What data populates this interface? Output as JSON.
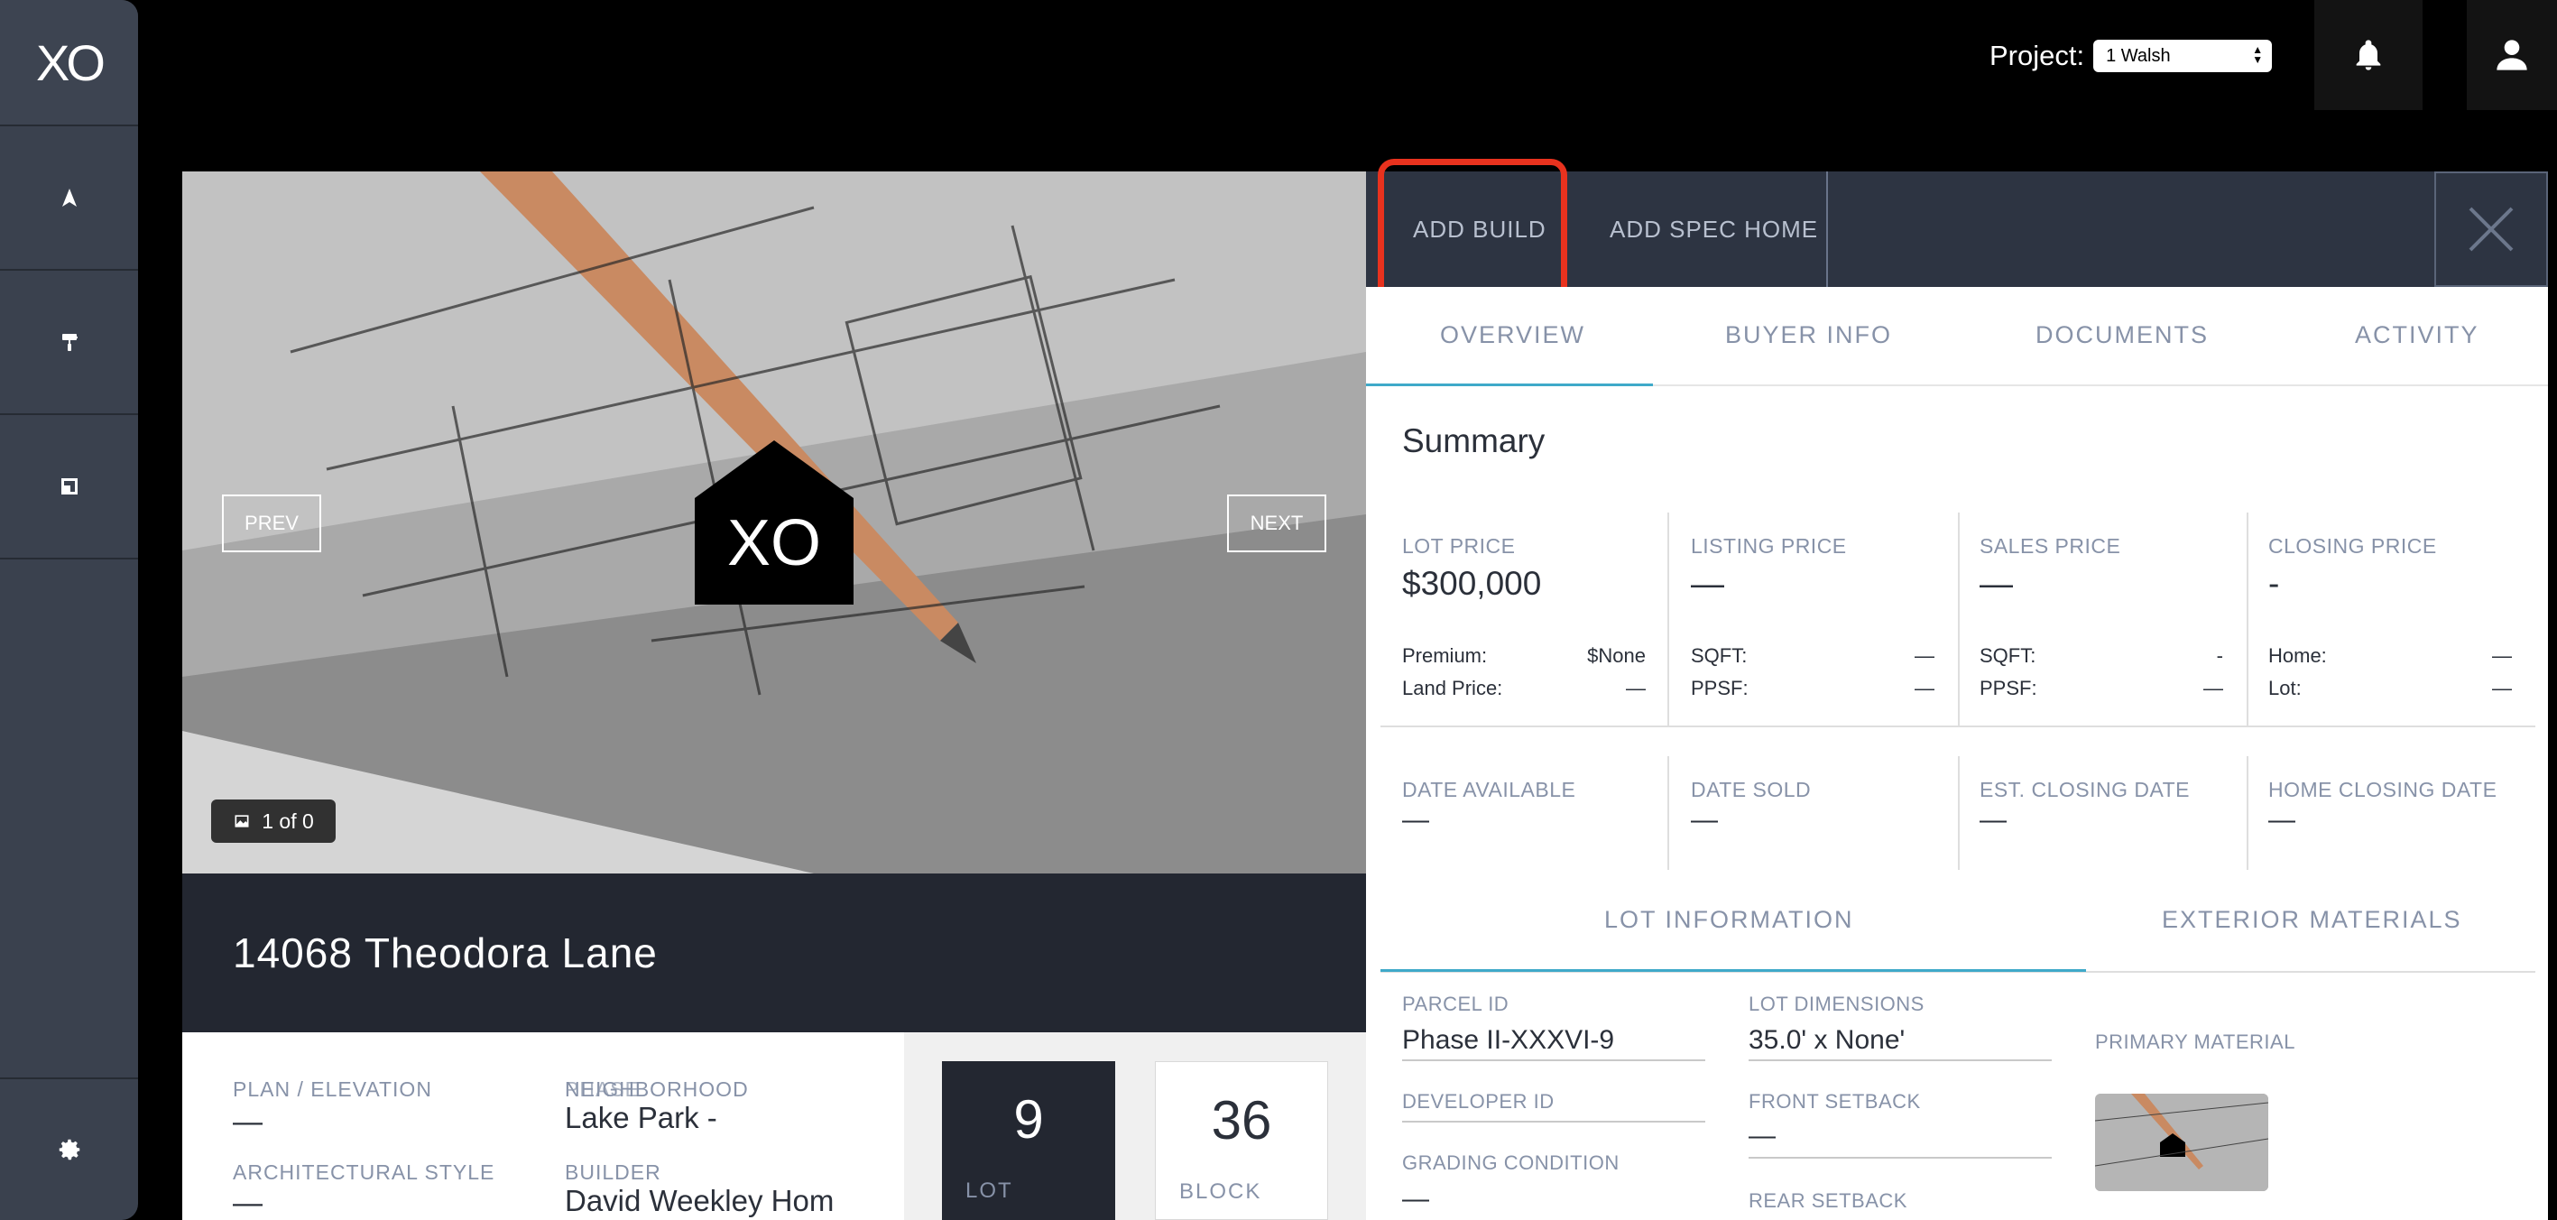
{
  "sidebar": {
    "logo": "XO"
  },
  "topbar": {
    "project_label": "Project:",
    "project_value": "1 Walsh"
  },
  "photo": {
    "prev_label": "PREV",
    "next_label": "NEXT",
    "counter": "1 of 0",
    "badge_text": "XO"
  },
  "property": {
    "address": "14068 Theodora Lane",
    "plan_elevation_label": "PLAN / ELEVATION",
    "plan_elevation_value": "—",
    "phase_label": "PHASE",
    "neighborhood_label": "NEIGHBORHOOD",
    "neighborhood_value": "Lake Park -",
    "architectural_style_label": "ARCHITECTURAL STYLE",
    "architectural_style_value": "—",
    "builder_label": "BUILDER",
    "builder_value": "David Weekley Hom",
    "lot_number": "9",
    "lot_label": "LOT",
    "block_number": "36",
    "block_label": "BLOCK"
  },
  "panel": {
    "add_build": "ADD BUILD",
    "add_spec_home": "ADD SPEC HOME",
    "tabs": [
      "OVERVIEW",
      "BUYER INFO",
      "DOCUMENTS",
      "ACTIVITY"
    ],
    "summary_title": "Summary",
    "prices": [
      {
        "label": "LOT PRICE",
        "value": "$300,000",
        "rows": [
          {
            "k": "Premium:",
            "v": "$None"
          },
          {
            "k": "Land Price:",
            "v": "—"
          }
        ]
      },
      {
        "label": "LISTING PRICE",
        "value": "—",
        "rows": [
          {
            "k": "SQFT:",
            "v": "—"
          },
          {
            "k": "PPSF:",
            "v": "—"
          }
        ]
      },
      {
        "label": "SALES PRICE",
        "value": "—",
        "rows": [
          {
            "k": "SQFT:",
            "v": "-"
          },
          {
            "k": "PPSF:",
            "v": "—"
          }
        ]
      },
      {
        "label": "CLOSING PRICE",
        "value": "-",
        "rows": [
          {
            "k": "Home:",
            "v": "—"
          },
          {
            "k": "Lot:",
            "v": "—"
          }
        ]
      }
    ],
    "dates": [
      {
        "label": "DATE AVAILABLE",
        "value": "—"
      },
      {
        "label": "DATE SOLD",
        "value": "—"
      },
      {
        "label": "EST. CLOSING DATE",
        "value": "—"
      },
      {
        "label": "HOME CLOSING DATE",
        "value": "—"
      }
    ],
    "subtabs": [
      "LOT INFORMATION",
      "EXTERIOR MATERIALS"
    ],
    "lot_info": {
      "parcel_id_label": "PARCEL ID",
      "parcel_id_value": "Phase II-XXXVI-9",
      "lot_dimensions_label": "LOT DIMENSIONS",
      "lot_dimensions_value": "35.0' x None'",
      "developer_id_label": "DEVELOPER ID",
      "developer_id_value": "",
      "front_setback_label": "FRONT SETBACK",
      "front_setback_value": "—",
      "grading_condition_label": "GRADING CONDITION",
      "grading_condition_value": "—",
      "rear_setback_label": "REAR SETBACK",
      "primary_material_label": "PRIMARY MATERIAL"
    }
  },
  "colors": {
    "sidebar": "#3a414e",
    "panel_header": "#2d3442",
    "address_band": "#232731",
    "tab_accent": "#3fa9c9",
    "highlight": "#e8321e"
  }
}
